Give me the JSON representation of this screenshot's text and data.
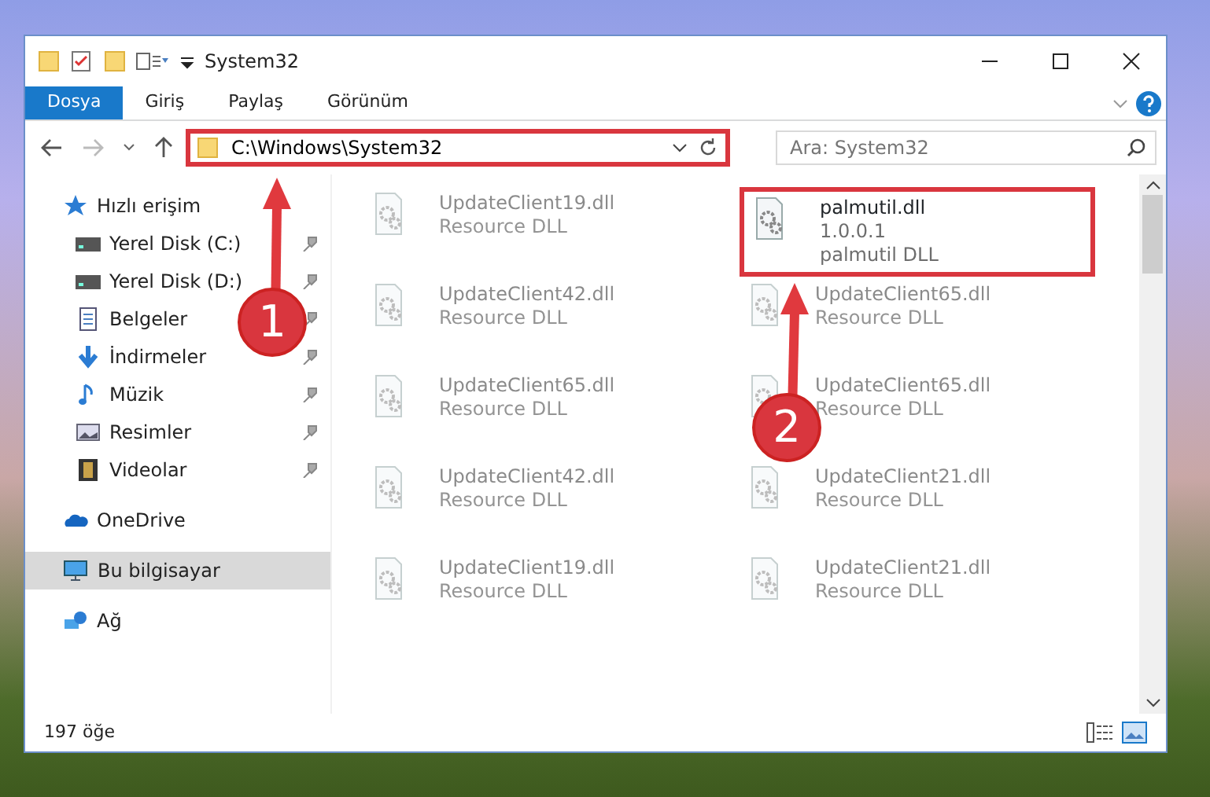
{
  "window": {
    "title": "System32"
  },
  "ribbon_tabs": [
    {
      "label": "Dosya",
      "selected": true
    },
    {
      "label": "Giriş",
      "selected": false
    },
    {
      "label": "Paylaş",
      "selected": false
    },
    {
      "label": "Görünüm",
      "selected": false
    }
  ],
  "address": {
    "path": "C:\\Windows\\System32",
    "highlighted": true
  },
  "search": {
    "placeholder": "Ara: System32"
  },
  "sidebar": {
    "items": [
      {
        "label": "Hızlı erişim",
        "kind": "star",
        "selected": false,
        "children": [
          {
            "label": "Yerel Disk (C:)",
            "kind": "disk",
            "pinned": true,
            "selected": false
          },
          {
            "label": "Yerel Disk (D:)",
            "kind": "disk",
            "pinned": true,
            "selected": false
          },
          {
            "label": "Belgeler",
            "kind": "doc",
            "pinned": true,
            "selected": false
          },
          {
            "label": "İndirmeler",
            "kind": "download",
            "pinned": true,
            "selected": false
          },
          {
            "label": "Müzik",
            "kind": "music",
            "pinned": true,
            "selected": false
          },
          {
            "label": "Resimler",
            "kind": "picture",
            "pinned": true,
            "selected": false
          },
          {
            "label": "Videolar",
            "kind": "film",
            "pinned": true,
            "selected": false
          }
        ]
      },
      {
        "label": "OneDrive",
        "kind": "cloud",
        "selected": false
      },
      {
        "label": "Bu bilgisayar",
        "kind": "pc",
        "selected": true
      },
      {
        "label": "Ağ",
        "kind": "network",
        "selected": false
      }
    ]
  },
  "files": [
    {
      "name": "UpdateClient19.dll",
      "type": "Resource DLL",
      "faded": true,
      "highlighted": false
    },
    {
      "name": "palmutil.dll",
      "version": "1.0.0.1",
      "type": "palmutil DLL",
      "faded": false,
      "highlighted": true
    },
    {
      "name": "UpdateClient42.dll",
      "type": "Resource DLL",
      "faded": true,
      "highlighted": false
    },
    {
      "name": "UpdateClient65.dll",
      "type": "Resource DLL",
      "faded": true,
      "highlighted": false
    },
    {
      "name": "UpdateClient65.dll",
      "type": "Resource DLL",
      "faded": true,
      "highlighted": false
    },
    {
      "name": "UpdateClient65.dll",
      "type": "Resource DLL",
      "faded": true,
      "highlighted": false
    },
    {
      "name": "UpdateClient42.dll",
      "type": "Resource DLL",
      "faded": true,
      "highlighted": false
    },
    {
      "name": "UpdateClient21.dll",
      "type": "Resource DLL",
      "faded": true,
      "highlighted": false
    },
    {
      "name": "UpdateClient19.dll",
      "type": "Resource DLL",
      "faded": true,
      "highlighted": false
    },
    {
      "name": "UpdateClient21.dll",
      "type": "Resource DLL",
      "faded": true,
      "highlighted": false
    }
  ],
  "status_bar": {
    "item_count": "197 öğe"
  },
  "callouts": [
    {
      "number": "1"
    },
    {
      "number": "2"
    }
  ]
}
